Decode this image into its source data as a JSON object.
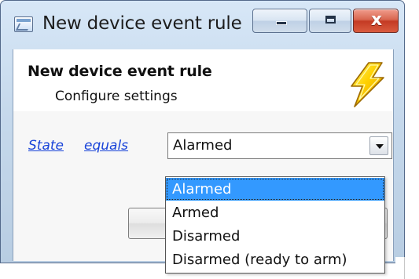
{
  "window": {
    "title": "New device event rule",
    "controls": {
      "minimize_icon": "minimize-icon",
      "maximize_icon": "maximize-icon",
      "close_icon": "close-icon",
      "close_symbol": "x"
    },
    "colors": {
      "title_bar": "#c6d9ec",
      "border": "#53698a",
      "close_button": "#d8664f"
    }
  },
  "dialog": {
    "heading": "New device event rule",
    "subheading": "Configure settings",
    "icon": "lightning-icon"
  },
  "rule": {
    "field_link": "State",
    "operator_link": "equals",
    "selected_value": "Alarmed",
    "options": [
      "Alarmed",
      "Armed",
      "Disarmed",
      "Disarmed (ready to arm)"
    ],
    "link_color": "#1843d9",
    "selection_color": "#3399ff"
  }
}
